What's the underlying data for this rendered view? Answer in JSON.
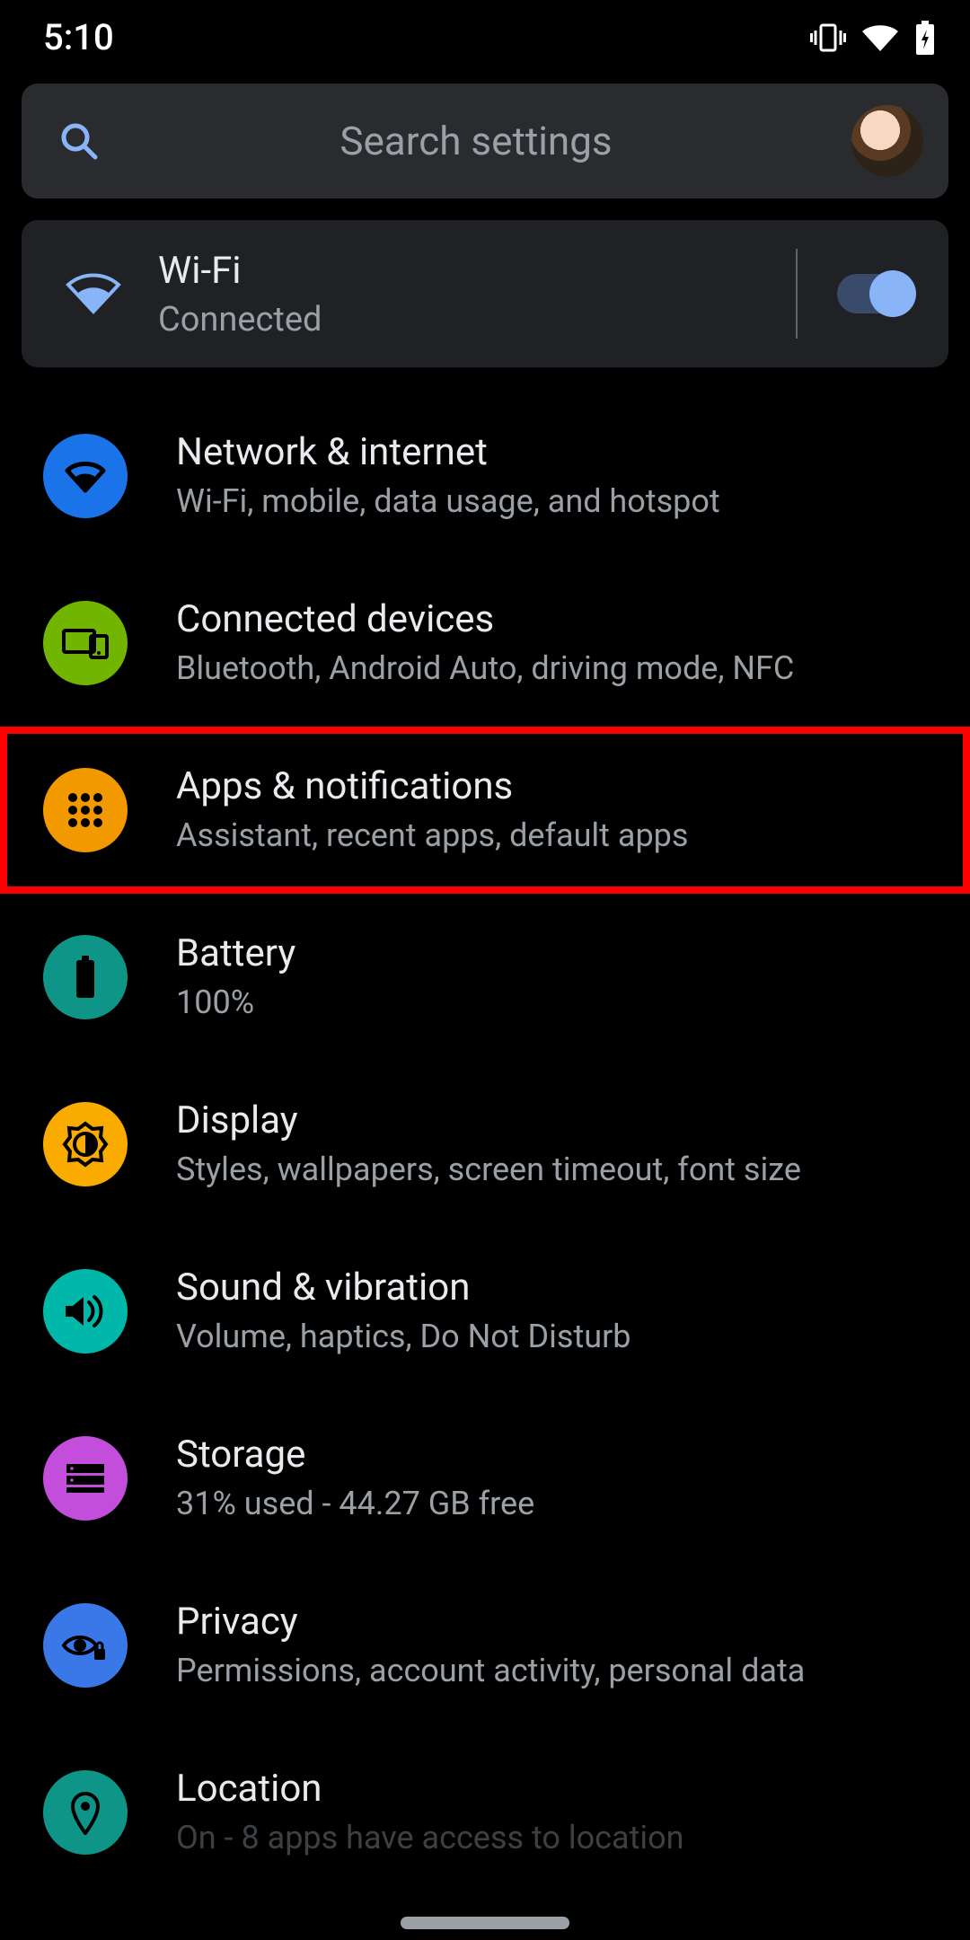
{
  "status": {
    "time": "5:10"
  },
  "search": {
    "placeholder": "Search settings"
  },
  "wifi_card": {
    "title": "Wi-Fi",
    "subtitle": "Connected",
    "toggle_on": true
  },
  "items": [
    {
      "title": "Network & internet",
      "subtitle": "Wi-Fi, mobile, data usage, and hotspot",
      "icon": "wifi",
      "color": "#1a73e8",
      "highlighted": false
    },
    {
      "title": "Connected devices",
      "subtitle": "Bluetooth, Android Auto, driving mode, NFC",
      "icon": "devices",
      "color": "#71b500",
      "highlighted": false
    },
    {
      "title": "Apps & notifications",
      "subtitle": "Assistant, recent apps, default apps",
      "icon": "apps",
      "color": "#f29900",
      "highlighted": true
    },
    {
      "title": "Battery",
      "subtitle": "100%",
      "icon": "battery",
      "color": "#0f9488",
      "highlighted": false
    },
    {
      "title": "Display",
      "subtitle": "Styles, wallpapers, screen timeout, font size",
      "icon": "brightness",
      "color": "#f9ab00",
      "highlighted": false
    },
    {
      "title": "Sound & vibration",
      "subtitle": "Volume, haptics, Do Not Disturb",
      "icon": "sound",
      "color": "#00b8a9",
      "highlighted": false
    },
    {
      "title": "Storage",
      "subtitle": "31% used - 44.27 GB free",
      "icon": "storage",
      "color": "#c34edc",
      "highlighted": false
    },
    {
      "title": "Privacy",
      "subtitle": "Permissions, account activity, personal data",
      "icon": "privacy",
      "color": "#3b78e7",
      "highlighted": false
    },
    {
      "title": "Location",
      "subtitle": "On - 8 apps have access to location",
      "icon": "location",
      "color": "#0f9488",
      "highlighted": false
    }
  ]
}
